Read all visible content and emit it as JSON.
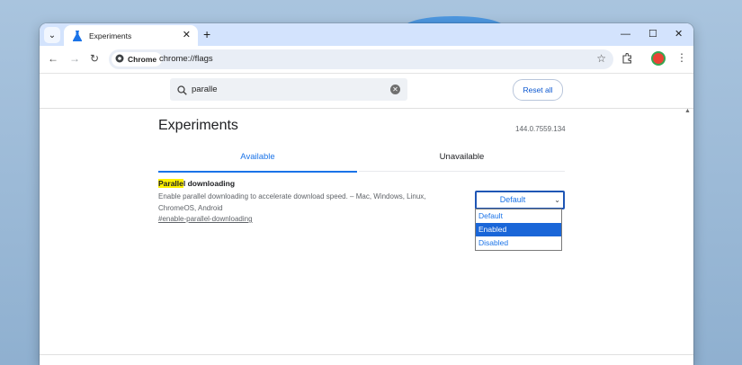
{
  "browser": {
    "tab": {
      "title": "Experiments",
      "close_glyph": "✕"
    },
    "new_tab_glyph": "+",
    "window_controls": {
      "minimize": "—",
      "maximize": "☐",
      "close": "✕"
    },
    "nav": {
      "back": "←",
      "forward": "→",
      "reload": "↻"
    },
    "omnibox": {
      "chip_label": "Chrome",
      "url": "chrome://flags",
      "star_glyph": "☆"
    },
    "menu_glyph": "⋮"
  },
  "flags_page": {
    "search": {
      "value": "paralle"
    },
    "reset_label": "Reset all",
    "title": "Experiments",
    "version": "144.0.7559.134",
    "tabs": [
      {
        "label": "Available",
        "active": true
      },
      {
        "label": "Unavailable",
        "active": false
      }
    ],
    "flag": {
      "name_highlight": "Paralle",
      "name_rest": "l downloading",
      "description_line1": "Enable parallel downloading to accelerate download speed. – Mac, Windows, Linux,",
      "description_line2": "ChromeOS, Android",
      "link": "#enable-parallel-downloading",
      "select_value": "Default",
      "options": [
        "Default",
        "Enabled",
        "Disabled"
      ],
      "highlighted_option": "Enabled"
    }
  },
  "colors": {
    "accent": "#1a73e8",
    "tabstrip": "#d3e3fd",
    "highlight": "#fdf100",
    "selected_option": "#1a66d8"
  }
}
